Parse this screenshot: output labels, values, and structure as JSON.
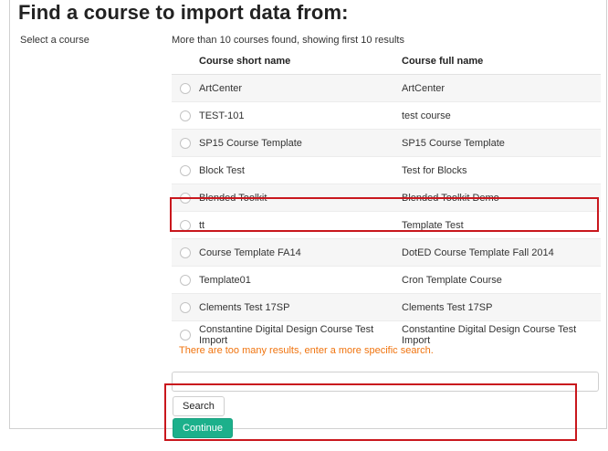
{
  "page": {
    "title": "Find a course to import data from:",
    "select_label": "Select a course",
    "results_note": "More than 10 courses found, showing first 10 results"
  },
  "table": {
    "headers": {
      "short_name": "Course short name",
      "full_name": "Course full name"
    },
    "rows": [
      {
        "short": "ArtCenter",
        "full": "ArtCenter"
      },
      {
        "short": "TEST-101",
        "full": "test course"
      },
      {
        "short": "SP15 Course Template",
        "full": "SP15 Course Template"
      },
      {
        "short": "Block Test",
        "full": "Test for Blocks"
      },
      {
        "short": "Blended Toolkit",
        "full": "Blended Toolkit Demo"
      },
      {
        "short": "tt",
        "full": "Template Test"
      },
      {
        "short": "Course Template FA14",
        "full": "DotED Course Template Fall 2014"
      },
      {
        "short": "Template01",
        "full": "Cron Template Course"
      },
      {
        "short": "Clements Test 17SP",
        "full": "Clements Test 17SP"
      },
      {
        "short": "Constantine Digital Design Course Test Import",
        "full": "Constantine Digital Design Course Test Import"
      }
    ]
  },
  "warning": "There are too many results, enter a more specific search.",
  "search": {
    "value": ""
  },
  "buttons": {
    "search": "Search",
    "continue": "Continue"
  },
  "colors": {
    "continue_bg": "#1cb08b",
    "warning_text": "#f0740f",
    "highlight_border": "#c9171d"
  }
}
